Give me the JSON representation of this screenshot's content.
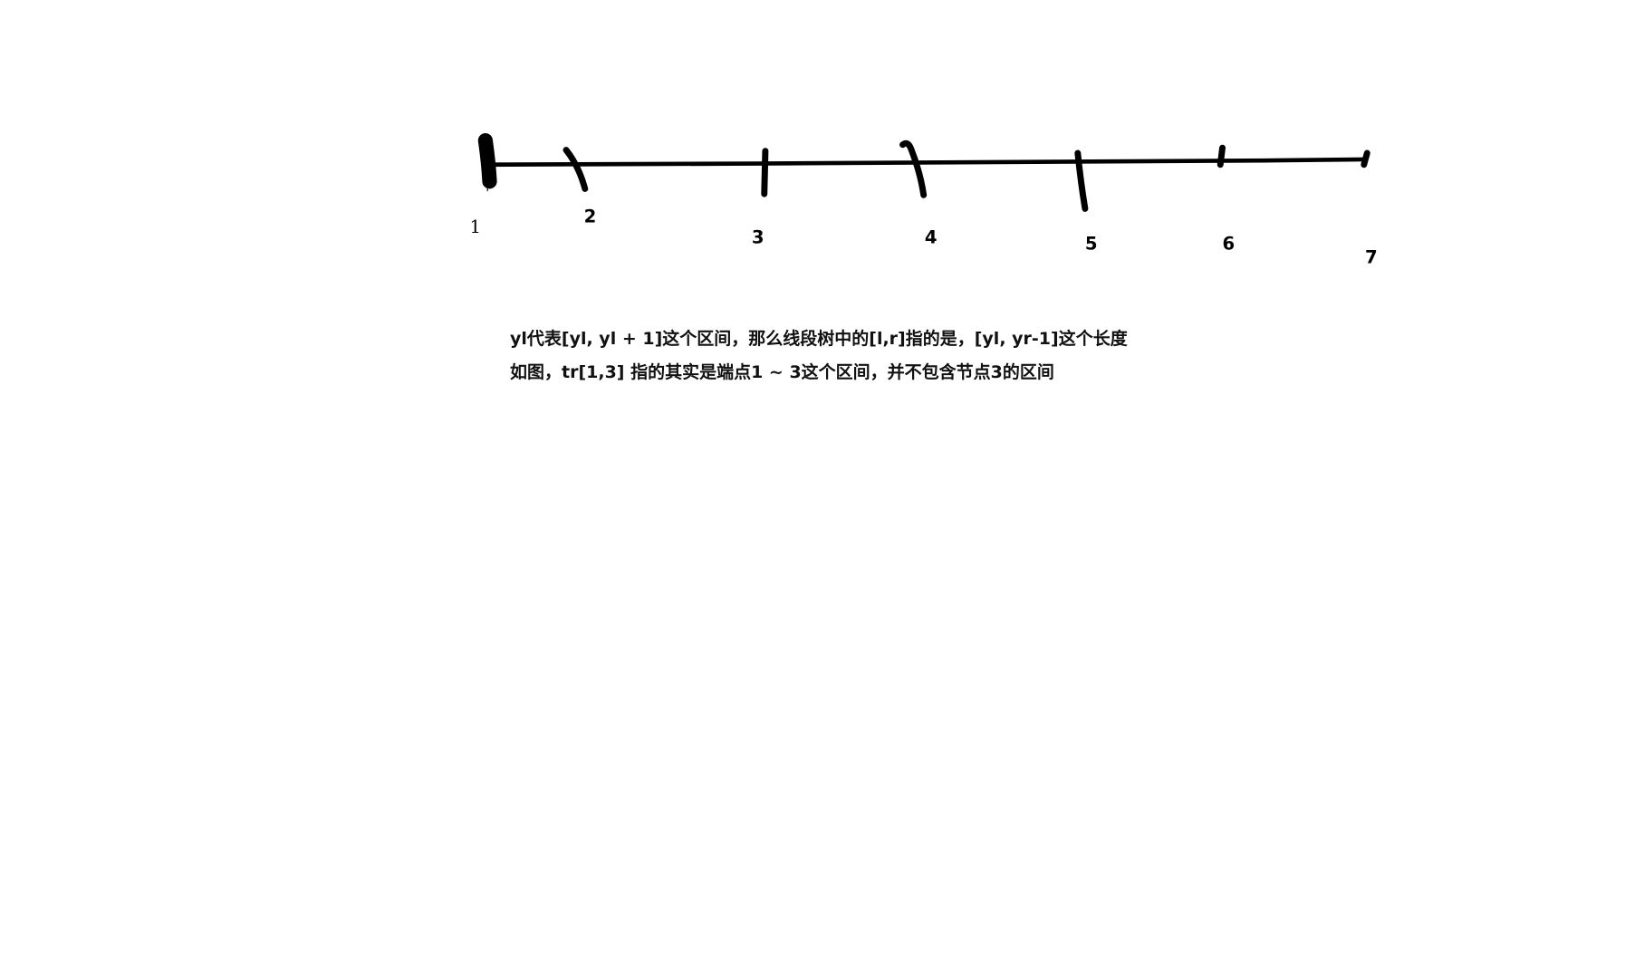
{
  "diagram": {
    "points": [
      "1",
      "2",
      "3",
      "4",
      "5",
      "6",
      "7"
    ],
    "stroke_color": "#000000"
  },
  "note": {
    "line1": "yl代表[yl, yl + 1]这个区间，那么线段树中的[l,r]指的是，[yl, yr-1]这个长度",
    "line2": "如图，tr[1,3] 指的其实是端点1 ~ 3这个区间，并不包含节点3的区间"
  }
}
